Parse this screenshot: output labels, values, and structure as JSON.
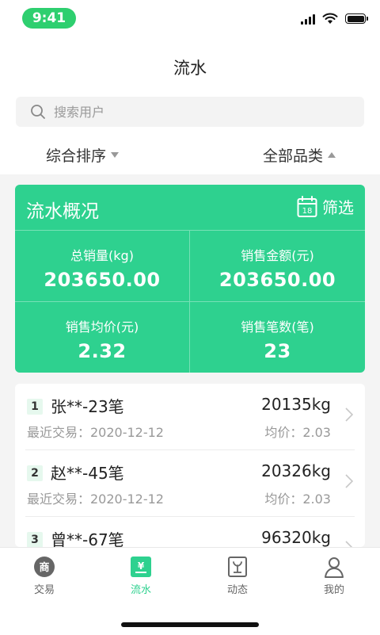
{
  "status_bar": {
    "time": "9:41"
  },
  "nav": {
    "title": "流水"
  },
  "search": {
    "placeholder": "搜索用户"
  },
  "filters": {
    "sort_label": "综合排序",
    "category_label": "全部品类"
  },
  "summary": {
    "title": "流水概况",
    "filter_label": "筛选",
    "calendar_day": "18",
    "stats": [
      {
        "label": "总销量(kg)",
        "value": "203650.00"
      },
      {
        "label": "销售金额(元)",
        "value": "203650.00"
      },
      {
        "label": "销售均价(元)",
        "value": "2.32"
      },
      {
        "label": "销售笔数(笔)",
        "value": "23"
      }
    ]
  },
  "list": {
    "items": [
      {
        "rank": "1",
        "name": "张**-23笔",
        "recent": "最近交易：2020-12-12",
        "weight": "20135kg",
        "avg": "均价：2.03"
      },
      {
        "rank": "2",
        "name": "赵**-45笔",
        "recent": "最近交易：2020-12-12",
        "weight": "20326kg",
        "avg": "均价：2.03"
      },
      {
        "rank": "3",
        "name": "曾**-67笔",
        "recent": "",
        "weight": "96320kg",
        "avg": ""
      }
    ]
  },
  "tabs": [
    {
      "label": "交易",
      "icon": "trade-icon",
      "active": false
    },
    {
      "label": "流水",
      "icon": "flow-icon",
      "active": true
    },
    {
      "label": "动态",
      "icon": "news-icon",
      "active": false
    },
    {
      "label": "我的",
      "icon": "profile-icon",
      "active": false
    }
  ],
  "colors": {
    "accent": "#2ed18f",
    "status_pill": "#2ecf6f"
  }
}
